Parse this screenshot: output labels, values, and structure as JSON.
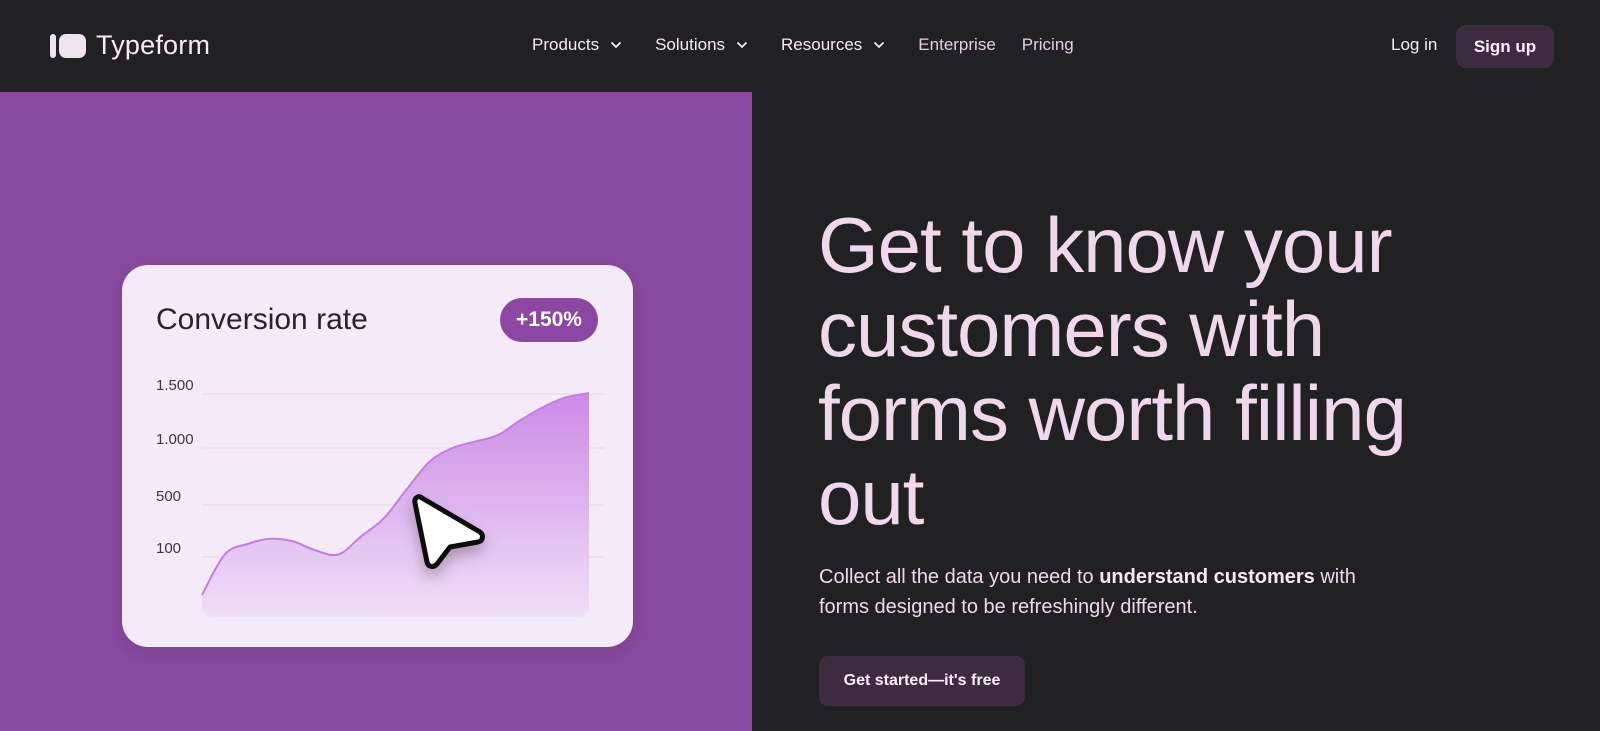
{
  "nav": {
    "brand": "Typeform",
    "menu": [
      {
        "label": "Products",
        "has_dropdown": true
      },
      {
        "label": "Solutions",
        "has_dropdown": true
      },
      {
        "label": "Resources",
        "has_dropdown": true
      }
    ],
    "links": [
      "Enterprise",
      "Pricing"
    ],
    "login_label": "Log in",
    "signup_label": "Sign up"
  },
  "hero": {
    "headline": "Get to know your customers with forms worth filling out",
    "sub_before": "Collect all the data you need to ",
    "sub_bold": "understand customers",
    "sub_after": " with forms designed to be refreshingly different.",
    "cta_label": "Get started—it's free"
  },
  "card": {
    "title": "Conversion rate",
    "badge": "+150%",
    "cursor_icon": "pointer-cursor-icon"
  },
  "chart_data": {
    "type": "area",
    "title": "Conversion rate",
    "y_ticks": [
      "1.500",
      "1.000",
      "500",
      "100"
    ],
    "y_tick_values": [
      1500,
      1000,
      500,
      100
    ],
    "series": [
      {
        "values": [
          [
            0,
            0
          ],
          [
            1,
            120
          ],
          [
            2,
            200
          ],
          [
            3,
            240
          ],
          [
            4,
            220
          ],
          [
            5,
            150
          ],
          [
            6,
            120
          ],
          [
            7,
            260
          ],
          [
            8,
            400
          ],
          [
            9,
            640
          ],
          [
            10,
            880
          ],
          [
            11,
            1000
          ],
          [
            12,
            1060
          ],
          [
            13,
            1120
          ],
          [
            14,
            1260
          ],
          [
            15,
            1380
          ],
          [
            16,
            1470
          ],
          [
            17,
            1510
          ]
        ]
      }
    ],
    "ylim": [
      0,
      1560
    ],
    "grid": true,
    "colors": {
      "fill_top": "#cc8ae6",
      "fill_bottom": "#f0e0f7",
      "line": "#c27ede"
    }
  },
  "colors": {
    "nav_bg": "#212023",
    "panel_purple": "#8a4aa0",
    "button_bg": "#3d2c40",
    "text_light": "#efd7ec"
  }
}
